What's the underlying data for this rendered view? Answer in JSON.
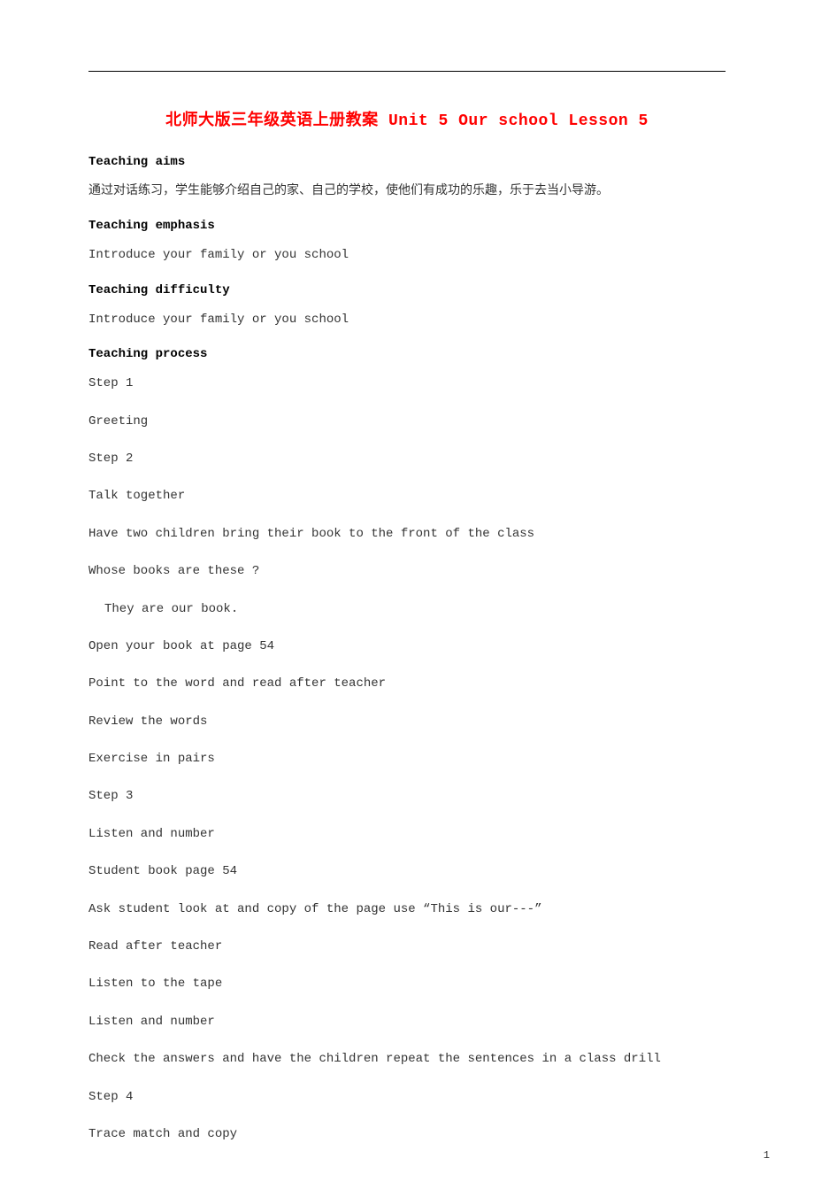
{
  "title": "北师大版三年级英语上册教案 Unit 5 Our school Lesson 5",
  "sections": {
    "teaching_aims": {
      "heading": "Teaching aims",
      "line1": "通过对话练习，学生能够介绍自己的家、自己的学校，使他们有成功的乐趣，乐于去当小导游。"
    },
    "teaching_emphasis": {
      "heading": "Teaching emphasis",
      "line1": "Introduce your family or you school"
    },
    "teaching_difficulty": {
      "heading": "Teaching difficulty",
      "line1": "Introduce your family or you school"
    },
    "teaching_process": {
      "heading": "Teaching process",
      "lines": [
        {
          "text": "Step 1",
          "indent": false
        },
        {
          "text": "Greeting",
          "indent": false
        },
        {
          "text": "Step 2",
          "indent": false
        },
        {
          "text": "Talk together",
          "indent": false
        },
        {
          "text": "Have two children bring their book to the front of the class",
          "indent": false
        },
        {
          "text": "Whose books are these ?",
          "indent": false
        },
        {
          "text": "They are our book.",
          "indent": true
        },
        {
          "text": "Open your book at page 54",
          "indent": false
        },
        {
          "text": "Point to the word and read after teacher",
          "indent": false
        },
        {
          "text": "Review the words",
          "indent": false
        },
        {
          "text": "Exercise in pairs",
          "indent": false
        },
        {
          "text": "Step 3",
          "indent": false
        },
        {
          "text": "Listen and number",
          "indent": false
        },
        {
          "text": "Student book page 54",
          "indent": false
        },
        {
          "text": "Ask student look at and copy of the page use  “This is our---”",
          "indent": false
        },
        {
          "text": "Read after teacher",
          "indent": false
        },
        {
          "text": "Listen to the tape",
          "indent": false
        },
        {
          "text": "Listen and number",
          "indent": false
        },
        {
          "text": "Check the answers and have the children repeat the sentences in a class drill",
          "indent": false
        },
        {
          "text": "Step 4",
          "indent": false
        },
        {
          "text": "Trace match and copy",
          "indent": false
        }
      ]
    }
  },
  "page_number": "1"
}
